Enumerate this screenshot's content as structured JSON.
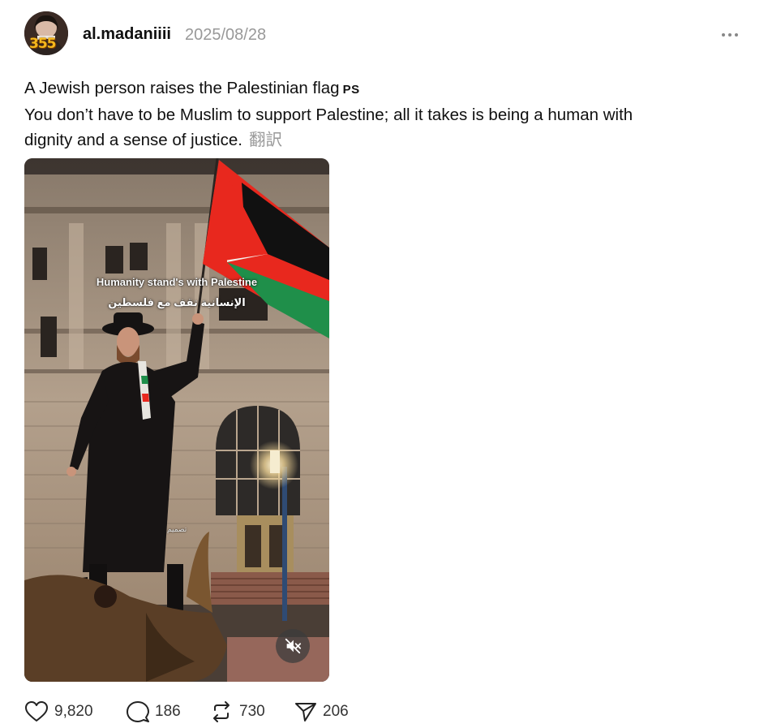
{
  "post": {
    "author": {
      "username": "al.madaniiii",
      "avatar_badge": "355"
    },
    "timestamp": "2025/08/28",
    "more_icon": "more-horizontal-icon",
    "caption": {
      "line1": "A Jewish person raises the Palestinian flag",
      "flag_tag": "PS",
      "line2": "You don’t have to be Muslim to support Palestine; all it takes is being a human with",
      "line3": "dignity and a sense of justice.",
      "translate_label": "翻訳"
    },
    "media": {
      "overlay_en": "Humanity stand's with Palestine",
      "overlay_ar": "الإنسانية تقف مع فلسطين",
      "overlay_small": "تصميم",
      "mute_icon": "volume-muted-icon"
    },
    "actions": {
      "likes": "9,820",
      "comments": "186",
      "reposts": "730",
      "shares": "206"
    }
  },
  "colors": {
    "text": "#101010",
    "muted": "#999999",
    "flag_red": "#e8281e",
    "flag_green": "#1f8f4a"
  }
}
